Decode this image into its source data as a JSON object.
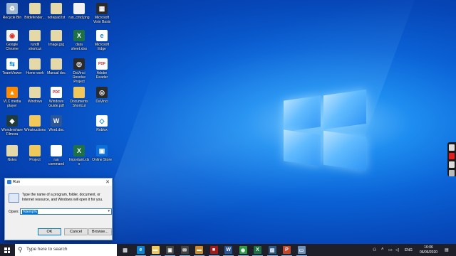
{
  "desktop_icons": [
    {
      "label": "Recycle Bin",
      "icon": "recycle-bin-icon",
      "color": "#9fb8cf"
    },
    {
      "label": "Bitdefender...",
      "icon": "document-icon",
      "color": "#e6d9a8"
    },
    {
      "label": "notepad.txt",
      "icon": "document-icon",
      "color": "#e6d9a8"
    },
    {
      "label": "run_cmd.png",
      "icon": "image-icon",
      "color": "#f2f2f2"
    },
    {
      "label": "Microsoft Visio Basis",
      "icon": "app-icon",
      "color": "#2b2b2b"
    },
    {
      "label": "Google Chrome",
      "icon": "chrome-icon",
      "color": "#f3f3f3"
    },
    {
      "label": "rundll shortcut",
      "icon": "document-icon",
      "color": "#e6d9a8"
    },
    {
      "label": "Image.jpg",
      "icon": "image-icon",
      "color": "#e6d9a8"
    },
    {
      "label": "data sheet.xlsx",
      "icon": "excel-icon",
      "color": "#1e7145"
    },
    {
      "label": "Microsoft Edge",
      "icon": "edge-icon",
      "color": "#ffffff"
    },
    {
      "label": "TeamViewer",
      "icon": "teamviewer-icon",
      "color": "#ffffff"
    },
    {
      "label": "Home work",
      "icon": "document-icon",
      "color": "#e6d9a8"
    },
    {
      "label": "Manual doc",
      "icon": "document-icon",
      "color": "#e6d9a8"
    },
    {
      "label": "DaVinci Resolve Project",
      "icon": "davinci-icon",
      "color": "#2a2a2a"
    },
    {
      "label": "Adobe Reader",
      "icon": "pdf-icon",
      "color": "#ffffff"
    },
    {
      "label": "VLC media player",
      "icon": "vlc-icon",
      "color": "#ff8c00"
    },
    {
      "label": "Windows",
      "icon": "document-icon",
      "color": "#e6d9a8"
    },
    {
      "label": "Windows Guide.pdf",
      "icon": "pdf-icon",
      "color": "#ffffff"
    },
    {
      "label": "Documents Shortcut",
      "icon": "folder-icon",
      "color": "#f0c95a"
    },
    {
      "label": "DaVinci",
      "icon": "davinci-icon",
      "color": "#2a2a2a"
    },
    {
      "label": "Wondershare Filmora",
      "icon": "filmora-icon",
      "color": "#1f3b3b"
    },
    {
      "label": "Winstructions",
      "icon": "folder-icon",
      "color": "#f0c95a"
    },
    {
      "label": "Word.doc",
      "icon": "word-icon",
      "color": "#2b579a"
    },
    {
      "label": "Roblox",
      "icon": "roblox-icon",
      "color": "#ffffff"
    },
    {
      "label": "Notes",
      "icon": "document-icon",
      "color": "#e6d9a8"
    },
    {
      "label": "Project",
      "icon": "folder-icon",
      "color": "#f0c95a"
    },
    {
      "label": "run command",
      "icon": "document-icon",
      "color": "#ffffff"
    },
    {
      "label": "Important.xlsx",
      "icon": "excel-icon",
      "color": "#1e7145"
    },
    {
      "label": "Online Store",
      "icon": "store-icon",
      "color": "#0a6fd6"
    }
  ],
  "run_dialog": {
    "title": "Run",
    "description": "Type the name of a program, folder, document, or Internet resource, and Windows will open it for you.",
    "open_label": "Open:",
    "open_value": "%temp%",
    "ok_label": "OK",
    "cancel_label": "Cancel",
    "browse_label": "Browse..."
  },
  "taskbar": {
    "search_placeholder": "Type here to search",
    "apps": [
      {
        "name": "task-view-icon",
        "glyph": "▥",
        "color": "transparent"
      },
      {
        "name": "edge-icon",
        "glyph": "e",
        "color": "#0a84d8"
      },
      {
        "name": "file-explorer-icon",
        "glyph": "▬",
        "color": "#f0c95a"
      },
      {
        "name": "store-icon",
        "glyph": "▣",
        "color": "#444"
      },
      {
        "name": "mail-icon",
        "glyph": "✉",
        "color": "#444"
      },
      {
        "name": "folder-icon",
        "glyph": "▬",
        "color": "#d08a2c"
      },
      {
        "name": "app-icon",
        "glyph": "■",
        "color": "#a31a1a"
      },
      {
        "name": "word-icon",
        "glyph": "W",
        "color": "#2b579a"
      },
      {
        "name": "chrome-icon",
        "glyph": "◉",
        "color": "#2e9d45"
      },
      {
        "name": "excel-icon",
        "glyph": "X",
        "color": "#1e7145"
      },
      {
        "name": "photos-icon",
        "glyph": "▨",
        "color": "#2c5a8a"
      },
      {
        "name": "powerpoint-icon",
        "glyph": "P",
        "color": "#c4462b"
      },
      {
        "name": "run-icon",
        "glyph": "▭",
        "color": "#6f90b8"
      }
    ],
    "tray": {
      "language": "ENG",
      "time": "16:06",
      "date": "06/06/2020"
    }
  },
  "colors": {
    "taskbar": "#1f1f2a",
    "accent": "#0078d7"
  }
}
